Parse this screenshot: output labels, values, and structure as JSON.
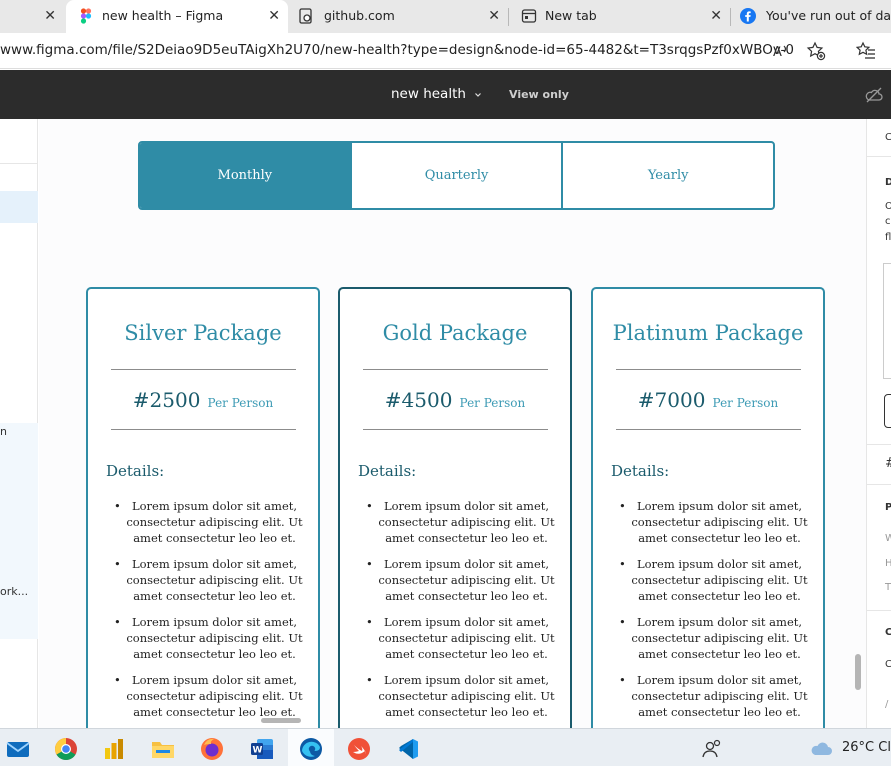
{
  "browser": {
    "tabs": [
      {
        "title": "",
        "icon": "close-icon"
      },
      {
        "title": "new health – Figma",
        "icon": "figma-icon",
        "active": true
      },
      {
        "title": "github.com",
        "icon": "github-icon"
      },
      {
        "title": "New tab",
        "icon": "new-tab-icon"
      },
      {
        "title": "You've run out of data.",
        "icon": "facebook-icon"
      }
    ],
    "url": "www.figma.com/file/S2Deiao9D5euTAigXh2U70/new-health?type=design&node-id=65-4482&t=T3srqgsPzf0xWBOv-0"
  },
  "figma": {
    "file_name": "new health",
    "view_mode": "View only",
    "left_panel_texts": [
      "n",
      "ork..."
    ],
    "right_panel_texts": [
      "C",
      "D",
      "O",
      "c",
      "fl",
      "#",
      "P",
      "W",
      "H",
      "T",
      "C",
      "C",
      "/"
    ]
  },
  "design": {
    "billing_options": [
      "Monthly",
      "Quarterly",
      "Yearly"
    ],
    "active_billing": "Monthly",
    "cards": [
      {
        "title": "Silver Package",
        "price": "#2500",
        "unit": "Per Person",
        "details_label": "Details:",
        "features": [
          "Lorem ipsum dolor sit amet, consectetur adipiscing elit. Ut amet consectetur leo leo et.",
          "Lorem ipsum dolor sit amet, consectetur adipiscing elit. Ut amet consectetur leo leo et.",
          "Lorem ipsum dolor sit amet, consectetur adipiscing elit. Ut amet consectetur leo leo et.",
          "Lorem ipsum dolor sit amet, consectetur adipiscing elit. Ut amet consectetur leo leo et."
        ]
      },
      {
        "title": "Gold Package",
        "price": "#4500",
        "unit": "Per Person",
        "details_label": "Details:",
        "features": [
          "Lorem ipsum dolor sit amet, consectetur adipiscing elit. Ut amet consectetur leo leo et.",
          "Lorem ipsum dolor sit amet, consectetur adipiscing elit. Ut amet consectetur leo leo et.",
          "Lorem ipsum dolor sit amet, consectetur adipiscing elit. Ut amet consectetur leo leo et.",
          "Lorem ipsum dolor sit amet, consectetur adipiscing elit. Ut amet consectetur leo leo et."
        ]
      },
      {
        "title": "Platinum Package",
        "price": "#7000",
        "unit": "Per Person",
        "details_label": "Details:",
        "features": [
          "Lorem ipsum dolor sit amet, consectetur adipiscing elit. Ut amet consectetur leo leo et.",
          "Lorem ipsum dolor sit amet, consectetur adipiscing elit. Ut amet consectetur leo leo et.",
          "Lorem ipsum dolor sit amet, consectetur adipiscing elit. Ut amet consectetur leo leo et.",
          "Lorem ipsum dolor sit amet, consectetur adipiscing elit. Ut amet consectetur leo leo et."
        ]
      }
    ],
    "colors": {
      "primary": "#2f8ca6",
      "dark": "#1b5b6c"
    }
  },
  "taskbar": {
    "icons": [
      "mail-icon",
      "chrome-icon",
      "power-bi-icon",
      "file-explorer-icon",
      "firefox-icon",
      "word-icon",
      "edge-icon",
      "swift-icon",
      "vscode-icon"
    ],
    "temperature": "26°C",
    "weather_suffix": "Cl"
  }
}
